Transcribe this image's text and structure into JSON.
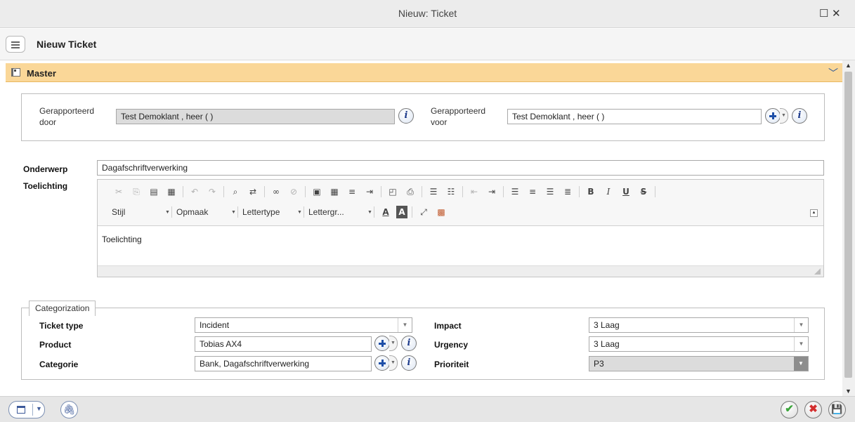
{
  "window": {
    "title": "Nieuw: Ticket",
    "restore_glyph": "☐",
    "close_glyph": "✕"
  },
  "header": {
    "title": "Nieuw Ticket"
  },
  "master": {
    "label": "Master",
    "icon": "layers-icon"
  },
  "reported": {
    "by_label_1": "Gerapporteerd",
    "by_label_2": "door",
    "by_value": "Test Demoklant , heer (  )",
    "for_label_1": "Gerapporteerd",
    "for_label_2": "voor",
    "for_value": "Test Demoklant , heer (  )"
  },
  "subject": {
    "label": "Onderwerp",
    "value": "Dagafschriftverwerking"
  },
  "explanation": {
    "label": "Toelichting",
    "content": "Toelichting",
    "combos": [
      "Stijl",
      "Opmaak",
      "Lettertype",
      "Lettergr..."
    ]
  },
  "categorization": {
    "legend": "Categorization",
    "ticket_type_label": "Ticket type",
    "ticket_type_value": "Incident",
    "product_label": "Product",
    "product_value": "Tobias AX4",
    "category_label": "Categorie",
    "category_value": "Bank, Dagafschriftverwerking",
    "impact_label": "Impact",
    "impact_value": "3 Laag",
    "urgency_label": "Urgency",
    "urgency_value": "3 Laag",
    "priority_label": "Prioriteit",
    "priority_value": "P3"
  },
  "colors": {
    "master_bar": "#fad798",
    "accent_blue": "#1e4fa8",
    "ok_green": "#3aa43a",
    "cancel_red": "#d32f2f"
  }
}
